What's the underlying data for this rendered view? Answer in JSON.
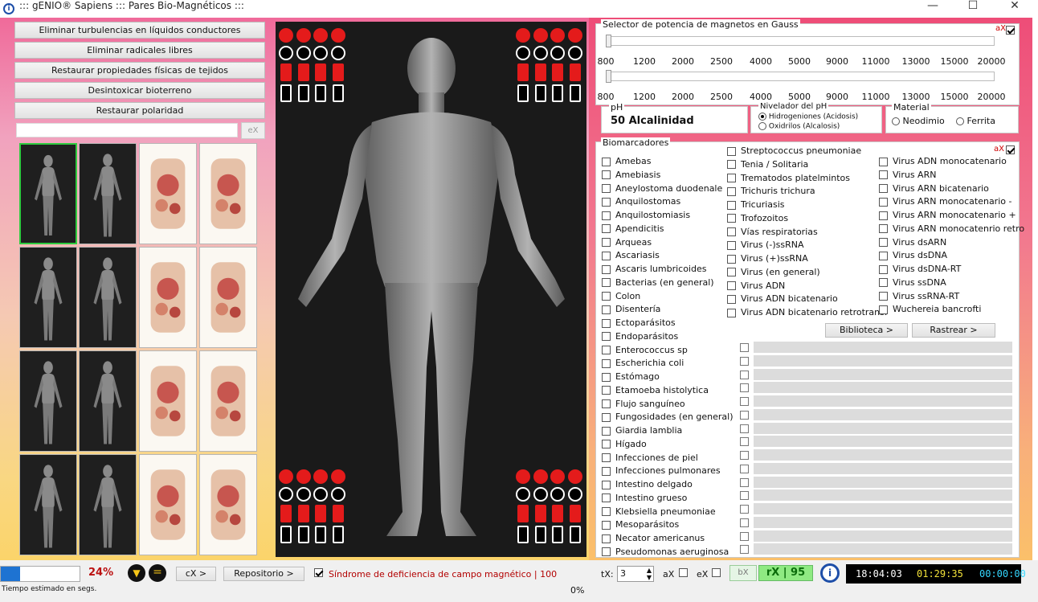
{
  "window": {
    "title": "::: gENIO® Sapiens ::: Pares Bio-Magnéticos :::",
    "minimize": "—",
    "maximize": "☐",
    "close": "✕"
  },
  "left_buttons": [
    "Eliminar turbulencias en líquidos conductores",
    "Eliminar radicales libres",
    "Restaurar propiedades físicas de tejidos",
    "Desintoxicar bioterreno",
    "Restaurar polaridad"
  ],
  "search": {
    "value": "",
    "ex_label": "eX"
  },
  "gauss": {
    "label": "Selector de potencia de magnetos en Gauss",
    "ax_label": "aX",
    "ticks": [
      "800",
      "1200",
      "2000",
      "2500",
      "4000",
      "5000",
      "9000",
      "11000",
      "13000",
      "15000",
      "20000"
    ]
  },
  "ph": {
    "label": "pH",
    "value": "50  Alcalinidad"
  },
  "nivelador": {
    "label": "Nivelador del pH",
    "options": [
      "Hidrogeniones (Acidosis)",
      "Oxidrilos (Alcalosis)"
    ],
    "selected": 0
  },
  "material": {
    "label": "Material",
    "options": [
      "Neodimio",
      "Ferrita"
    ]
  },
  "biomarcadores": {
    "label": "Biomarcadores",
    "ax_label": "aX",
    "col1": [
      "Amebas",
      "Amebiasis",
      "Aneylostoma duodenale",
      "Anquilostomas",
      "Anquilostomiasis",
      "Apendicitis",
      "Arqueas",
      "Ascariasis",
      "Ascaris lumbricoides",
      "Bacterias (en general)",
      "Colon",
      "Disentería",
      "Ectoparásitos",
      "Endoparásitos",
      "Enterococcus sp",
      "Escherichia coli",
      "Estómago",
      "Etamoeba histolytica",
      "Flujo sanguíneo",
      "Fungosidades (en general)",
      "Giardia lamblia",
      "Hígado",
      "Infecciones de piel",
      "Infecciones pulmonares",
      "Intestino delgado",
      "Intestino grueso",
      "Klebsiella pneumoniae",
      "Mesoparásitos",
      "Necator americanus",
      "Pseudomonas aeruginosa"
    ],
    "col2": [
      "Streptococcus pneumoniae",
      "Tenia / Solitaria",
      "Trematodos platelmintos",
      "Trichuris trichura",
      "Tricuriasis",
      "Trofozoitos",
      "Vías respiratorias",
      "Virus (-)ssRNA",
      "Virus (+)ssRNA",
      "Virus (en general)",
      "Virus ADN",
      "Virus ADN bicatenario",
      "Virus ADN bicatenario retrotrans."
    ],
    "col3": [
      "Virus ADN monocatenario",
      "Virus ARN",
      "Virus ARN bicatenario",
      "Virus ARN monocatenario -",
      "Virus ARN monocatenario +",
      "Virus ARN monocatenrio retro",
      "Virus dsARN",
      "Virus dsDNA",
      "Virus dsDNA-RT",
      "Virus ssDNA",
      "Virus ssRNA-RT",
      "Wuchereia bancrofti"
    ],
    "biblioteca": "Biblioteca >",
    "rastrear": "Rastrear >"
  },
  "bottom": {
    "progress_pct": "24%",
    "cx": "cX >",
    "repositorio": "Repositorio >",
    "sindrome": "Síndrome de deficiencia de campo magnético | 100",
    "tx_label": "tX:",
    "tx_value": "3",
    "ax": "aX",
    "ex": "eX",
    "bx": "bX",
    "rx": "rX | 95",
    "time1": "18:04:03",
    "time2": "01:29:35",
    "time3": "00:00:00",
    "tiempo": "Tiempo estimado en segs.",
    "zero_pct": "0%"
  },
  "colors": {
    "accent_red": "#e41b1b",
    "green": "#2ecc40",
    "time_yellow": "#f3e23a",
    "time_cyan": "#34d7ff"
  }
}
